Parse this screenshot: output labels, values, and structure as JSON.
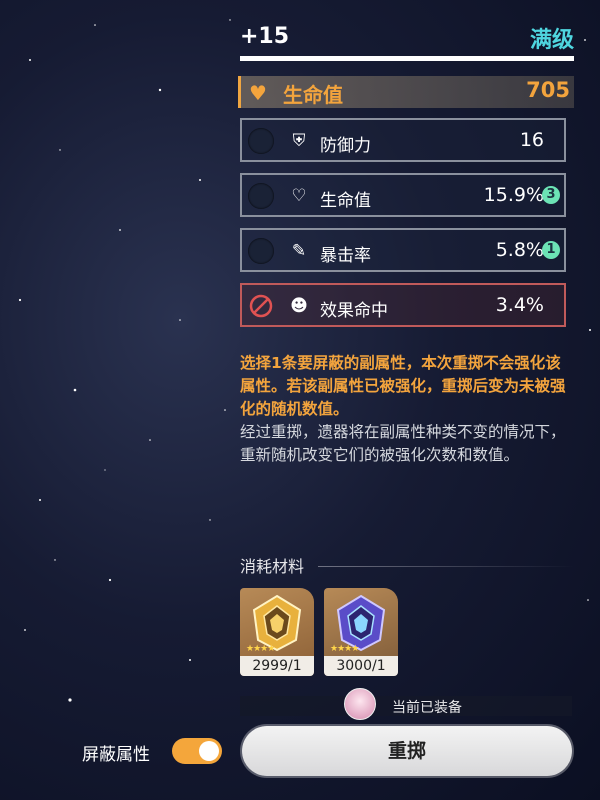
{
  "header": {
    "level": "+15",
    "max_label": "满级"
  },
  "main_stat": {
    "icon": "heart-icon",
    "name": "生命值",
    "value": "705",
    "color": "#f3a43d"
  },
  "substats": [
    {
      "icon": "shield-icon",
      "name": "防御力",
      "value": "16",
      "badge": ""
    },
    {
      "icon": "heart-icon",
      "name": "生命值",
      "value": "15.9%",
      "badge": "3"
    },
    {
      "icon": "crit-icon",
      "name": "暴击率",
      "value": "5.8%",
      "badge": "1"
    },
    {
      "icon": "effect-hit-icon",
      "name": "效果命中",
      "value": "3.4%",
      "badge": "",
      "blocked": true
    }
  ],
  "description": {
    "highlight": "选择1条要屏蔽的副属性，本次重掷不会强化该属性。若该副属性已被强化，重掷后变为未被强化的随机数值。",
    "normal": "经过重掷，遗器将在副属性种类不变的情况下，重新随机改变它们的被强化次数和数值。"
  },
  "materials": {
    "title": "消耗材料",
    "items": [
      {
        "icon": "gold-cube-icon",
        "count": "2999/1"
      },
      {
        "icon": "purple-cube-icon",
        "count": "3000/1"
      }
    ]
  },
  "equipped_label": "当前已装备",
  "shield_label": "屏蔽属性",
  "shield_toggle_on": true,
  "reroll_button": "重掷",
  "colors": {
    "accent": "#f3a43d",
    "max": "#4fd6df",
    "badge": "#6ce3b5",
    "blocked": "#c05a5a"
  }
}
